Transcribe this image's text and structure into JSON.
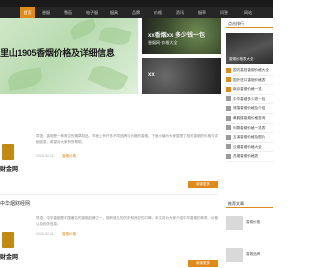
{
  "nav": {
    "items": [
      "首页",
      "香烟",
      "雪茄",
      "电子烟",
      "烟具",
      "品牌",
      "价格",
      "资讯",
      "烟草",
      "问答",
      "网站"
    ],
    "active_index": 1
  },
  "hero": {
    "main_title": "里山1905香烟价格及详细信息",
    "side_top_caption": "xx香烟xx 多少钱一包",
    "side_top_sub": "香烟网·价格大全",
    "side_bottom_caption": "xx"
  },
  "sidebar": {
    "hot_title": "点击排行",
    "feature_caption": "香烟价格表大全",
    "hot_items": [
      "国内高档香烟价格大全",
      "国外进口香烟价格表",
      "南京香烟价格一览",
      "中华香烟多少钱一包",
      "熊猫香烟价格及介绍",
      "黄鹤楼香烟价格查询",
      "利群香烟价格一览表",
      "玉溪香烟价格及图片",
      "云烟香烟价格大全",
      "苏烟香烟价格表"
    ],
    "rec_title": "推荐文章",
    "rec_items": [
      "香烟价格",
      "香烟品牌"
    ]
  },
  "articles": [
    {
      "title": "",
      "logo_text": "财金网",
      "summary": "导语：香烟是一种常见的烟草制品，市面上有许多不同品牌与价格的香烟。下面小编为大家整理了相关香烟的价格与详细信息，希望对大家有所帮助。",
      "date": "2020-02-11",
      "tag": "香烟价格",
      "more": "阅读更多"
    },
    {
      "title": "中华烟财经网",
      "logo_text": "财金网",
      "summary": "导语：中华香烟是中国著名的香烟品牌之一，拥有悠久的历史和良好的口碑。本文将为大家介绍中华香烟的种类、价格以及相关信息。",
      "date": "2020-02-11",
      "tag": "香烟价格",
      "more": "阅读更多"
    }
  ]
}
